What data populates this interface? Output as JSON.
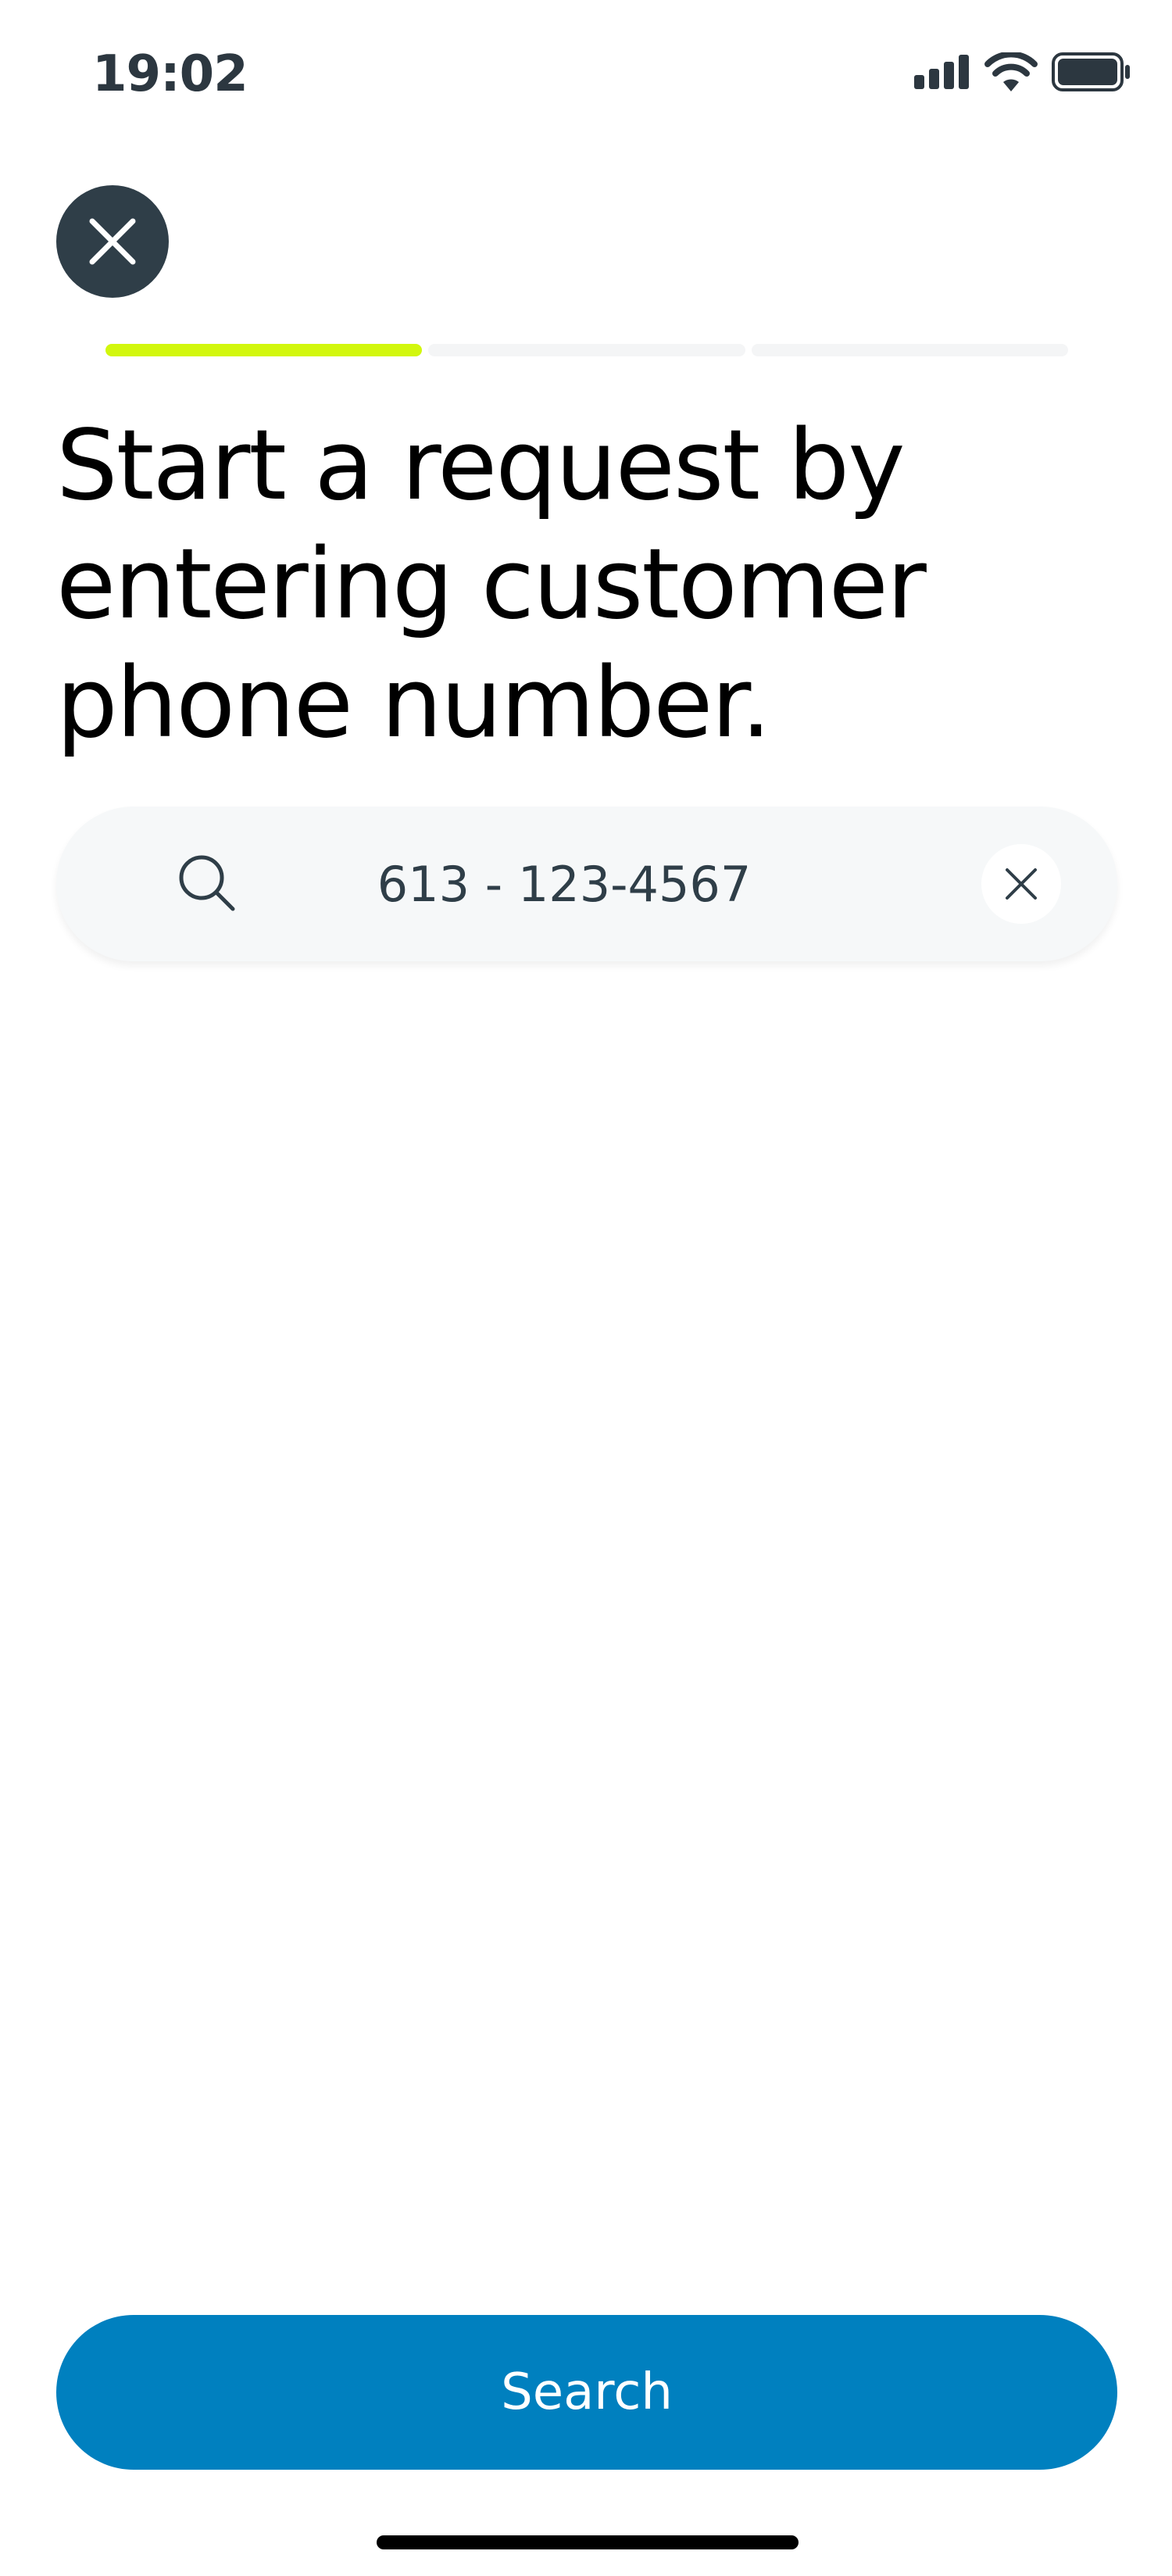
{
  "status_bar": {
    "time": "19:02",
    "icons": [
      "cellular-signal-icon",
      "wifi-icon",
      "battery-icon"
    ]
  },
  "header": {
    "close_icon": "close-icon"
  },
  "progress": {
    "total_steps": 3,
    "current_step": 1,
    "active_color": "#d2f70d"
  },
  "title": "Start a request by entering customer phone number.",
  "search": {
    "value": "613 - 123-4567",
    "placeholder": "",
    "icon": "search-icon",
    "clear_icon": "close-icon"
  },
  "actions": {
    "search_label": "Search",
    "button_color": "#0080bf"
  }
}
